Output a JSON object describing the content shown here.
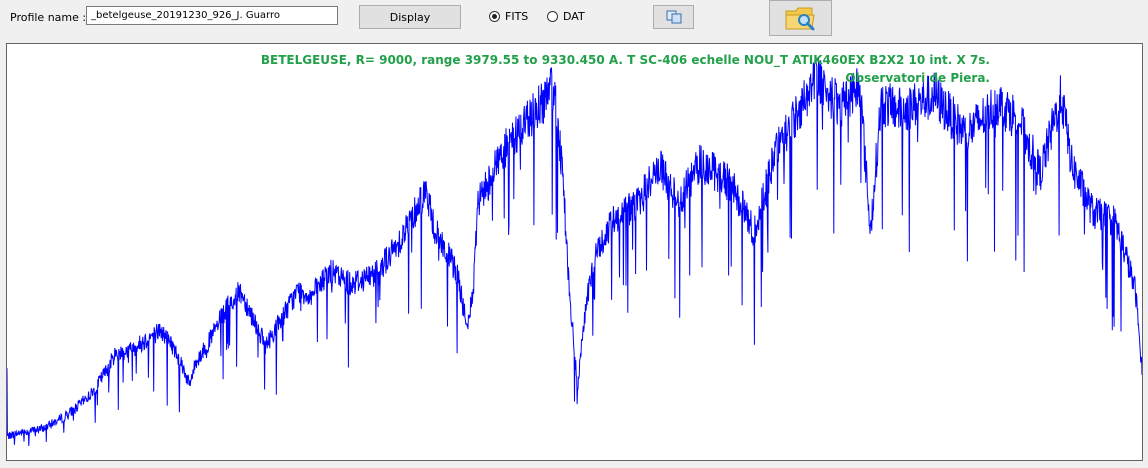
{
  "toolbar": {
    "profile_label": "Profile name :",
    "profile_value": "_betelgeuse_20191230_926_J. Guarro",
    "display_label": "Display",
    "format_options": [
      {
        "label": "FITS",
        "selected": true
      },
      {
        "label": "DAT",
        "selected": false
      }
    ],
    "copy_icon": "copy-icon",
    "open_icon": "folder-search-icon"
  },
  "plot": {
    "annotation_line1": "BETELGEUSE, R= 9000,  range 3979.55  to  9330.450 A. T SC-406 echelle NOU_T  ATIK460EX   B2X2   10 int. X  7s.",
    "annotation_line2": "Observatori de Piera.",
    "colors": {
      "line": "#0000ff",
      "annotation": "#22a04a",
      "background": "#ffffff"
    }
  },
  "chart_data": {
    "type": "line",
    "xlim": [
      3979.55,
      9330.45
    ],
    "grid": false,
    "series": [
      {
        "values": [
          [
            3979.6,
            0.03
          ],
          [
            4050,
            0.04
          ],
          [
            4150,
            0.05
          ],
          [
            4250,
            0.08
          ],
          [
            4300,
            0.1
          ],
          [
            4380,
            0.14
          ],
          [
            4450,
            0.2
          ],
          [
            4490,
            0.24
          ],
          [
            4560,
            0.25
          ],
          [
            4620,
            0.27
          ],
          [
            4700,
            0.3
          ],
          [
            4750,
            0.27
          ],
          [
            4800,
            0.22
          ],
          [
            4840,
            0.16
          ],
          [
            4870,
            0.22
          ],
          [
            4920,
            0.26
          ],
          [
            5020,
            0.36
          ],
          [
            5080,
            0.4
          ],
          [
            5150,
            0.32
          ],
          [
            5200,
            0.26
          ],
          [
            5250,
            0.31
          ],
          [
            5350,
            0.4
          ],
          [
            5420,
            0.39
          ],
          [
            5500,
            0.45
          ],
          [
            5600,
            0.42
          ],
          [
            5700,
            0.44
          ],
          [
            5800,
            0.5
          ],
          [
            5900,
            0.6
          ],
          [
            5950,
            0.66
          ],
          [
            6000,
            0.55
          ],
          [
            6050,
            0.5
          ],
          [
            6100,
            0.45
          ],
          [
            6150,
            0.3
          ],
          [
            6180,
            0.42
          ],
          [
            6200,
            0.62
          ],
          [
            6300,
            0.74
          ],
          [
            6450,
            0.85
          ],
          [
            6560,
            0.92
          ],
          [
            6600,
            0.7
          ],
          [
            6630,
            0.4
          ],
          [
            6670,
            0.15
          ],
          [
            6700,
            0.33
          ],
          [
            6750,
            0.49
          ],
          [
            6850,
            0.59
          ],
          [
            6950,
            0.62
          ],
          [
            7050,
            0.72
          ],
          [
            7150,
            0.63
          ],
          [
            7250,
            0.73
          ],
          [
            7400,
            0.67
          ],
          [
            7500,
            0.55
          ],
          [
            7600,
            0.75
          ],
          [
            7700,
            0.85
          ],
          [
            7800,
            0.95
          ],
          [
            7900,
            0.87
          ],
          [
            8000,
            0.93
          ],
          [
            8050,
            0.55
          ],
          [
            8100,
            0.88
          ],
          [
            8200,
            0.86
          ],
          [
            8350,
            0.9
          ],
          [
            8500,
            0.8
          ],
          [
            8650,
            0.88
          ],
          [
            8750,
            0.84
          ],
          [
            8850,
            0.7
          ],
          [
            8950,
            0.9
          ],
          [
            9000,
            0.72
          ],
          [
            9100,
            0.6
          ],
          [
            9200,
            0.58
          ],
          [
            9250,
            0.5
          ],
          [
            9300,
            0.4
          ],
          [
            9330.4,
            0.2
          ]
        ]
      }
    ]
  }
}
